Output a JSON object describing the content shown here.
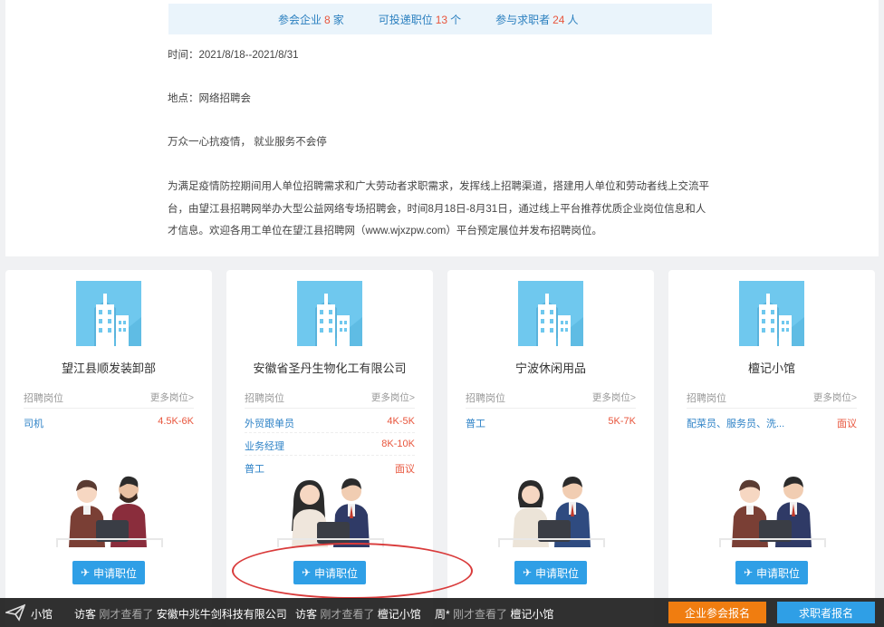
{
  "stats": [
    {
      "label": "参会企业",
      "value": "8",
      "unit": "家"
    },
    {
      "label": "可投递职位",
      "value": "13",
      "unit": "个"
    },
    {
      "label": "参与求职者",
      "value": "24",
      "unit": "人"
    }
  ],
  "info": {
    "time": "时间：2021/8/18--2021/8/31",
    "place": "地点：网络招聘会",
    "slogan": "万众一心抗疫情， 就业服务不会停",
    "description": "为满足疫情防控期间用人单位招聘需求和广大劳动者求职需求，发挥线上招聘渠道，搭建用人单位和劳动者线上交流平台，由望江县招聘网举办大型公益网络专场招聘会，时间8月18日-8月31日，通过线上平台推荐优质企业岗位信息和人才信息。欢迎各用工单位在望江县招聘网（www.wjxzpw.com）平台预定展位并发布招聘岗位。"
  },
  "card_labels": {
    "jobs_header": "招聘岗位",
    "more_jobs": "更多岗位>",
    "apply_button": "申请职位"
  },
  "companies": [
    {
      "name": "望江县顺发装卸部",
      "jobs": [
        {
          "title": "司机",
          "salary": "4.5K-6K"
        }
      ]
    },
    {
      "name": "安徽省圣丹生物化工有限公司",
      "jobs": [
        {
          "title": "外贸跟单员",
          "salary": "4K-5K"
        },
        {
          "title": "业务经理",
          "salary": "8K-10K"
        },
        {
          "title": "普工",
          "salary": "面议"
        }
      ]
    },
    {
      "name": "宁波休闲用品",
      "jobs": [
        {
          "title": "普工",
          "salary": "5K-7K"
        }
      ]
    },
    {
      "name": "檀记小馆",
      "jobs": [
        {
          "title": "配菜员、服务员、洗...",
          "salary": "面议"
        }
      ]
    }
  ],
  "ticker": {
    "item0": "小馆",
    "item1_prefix": "访客",
    "item1_mid": "刚才查看了",
    "item1_target": "安徽中兆牛剑科技有限公司",
    "item2_prefix": "访客",
    "item2_mid": "刚才查看了",
    "item2_target": "檀记小馆",
    "item3_prefix": "周*",
    "item3_mid": "刚才查看了",
    "item3_target": "檀记小馆"
  },
  "actions": {
    "company_signup": "企业参会报名",
    "seeker_signup": "求职者报名"
  },
  "colors": {
    "accent_blue": "#2f9fe6",
    "accent_orange": "#f07d10",
    "highlight_red": "#e8553c"
  }
}
